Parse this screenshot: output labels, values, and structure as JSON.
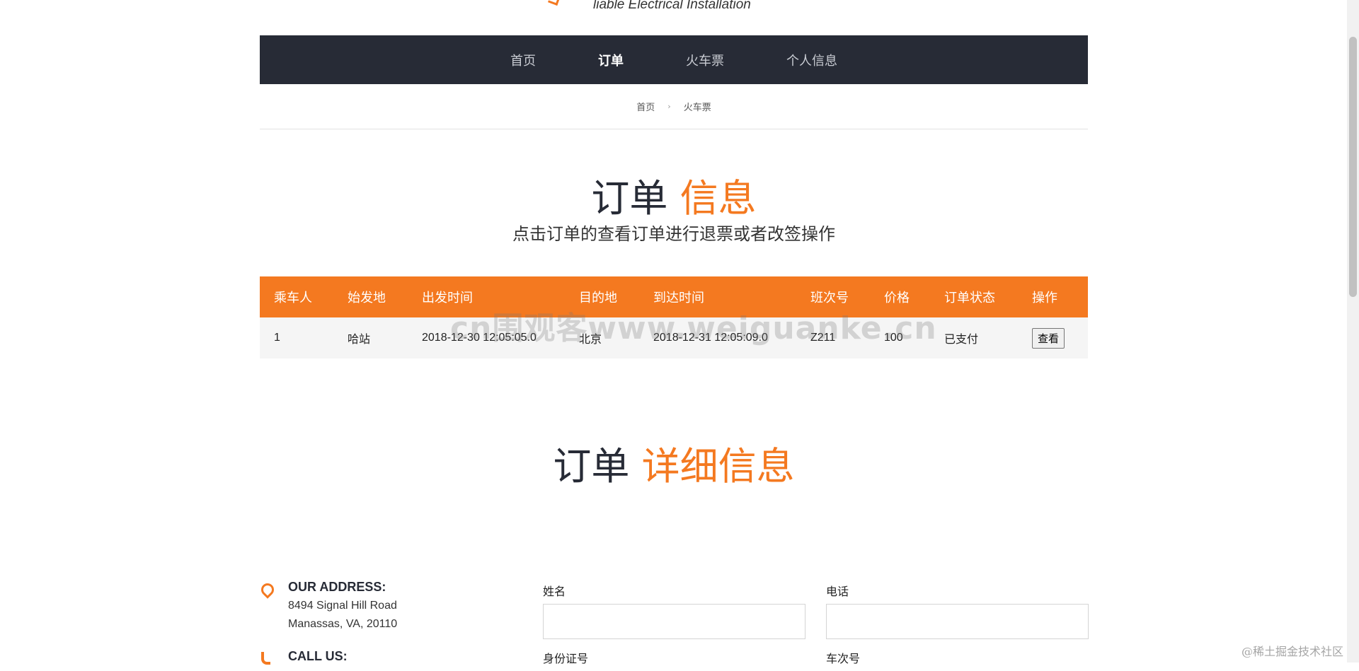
{
  "logo": {
    "tagline": "liable Electrical Installation"
  },
  "nav": {
    "items": [
      {
        "label": "首页"
      },
      {
        "label": "订单"
      },
      {
        "label": "火车票"
      },
      {
        "label": "个人信息"
      }
    ],
    "active_index": 1
  },
  "breadcrumb": {
    "items": [
      "首页",
      "火车票"
    ],
    "separator": "›"
  },
  "order_section": {
    "title_main": "订单",
    "title_accent": "信息",
    "subtitle": "点击订单的查看订单进行退票或者改签操作"
  },
  "table": {
    "headers": [
      "乘车人",
      "始发地",
      "出发时间",
      "目的地",
      "到达时间",
      "班次号",
      "价格",
      "订单状态",
      "操作"
    ],
    "rows": [
      [
        "1",
        "哈站",
        "2018-12-30 12:05:05.0",
        "北京",
        "2018-12-31 12:05:09.0",
        "Z211",
        "100",
        "已支付",
        "查看"
      ]
    ]
  },
  "watermark": "cn围观客www.weiguanke.cn",
  "detail_section": {
    "title_main": "订单",
    "title_accent": "详细信息"
  },
  "contact": {
    "address_title": "OUR ADDRESS:",
    "address_line1": "8494 Signal Hill Road",
    "address_line2": "Manassas, VA, 20110",
    "call_title": "CALL US:"
  },
  "form": {
    "name_label": "姓名",
    "phone_label": "电话",
    "id_label": "身份证号",
    "train_label": "车次号"
  },
  "corner_mark": "@稀土掘金技术社区",
  "colors": {
    "accent": "#f47920",
    "nav_bg": "#272b36"
  }
}
